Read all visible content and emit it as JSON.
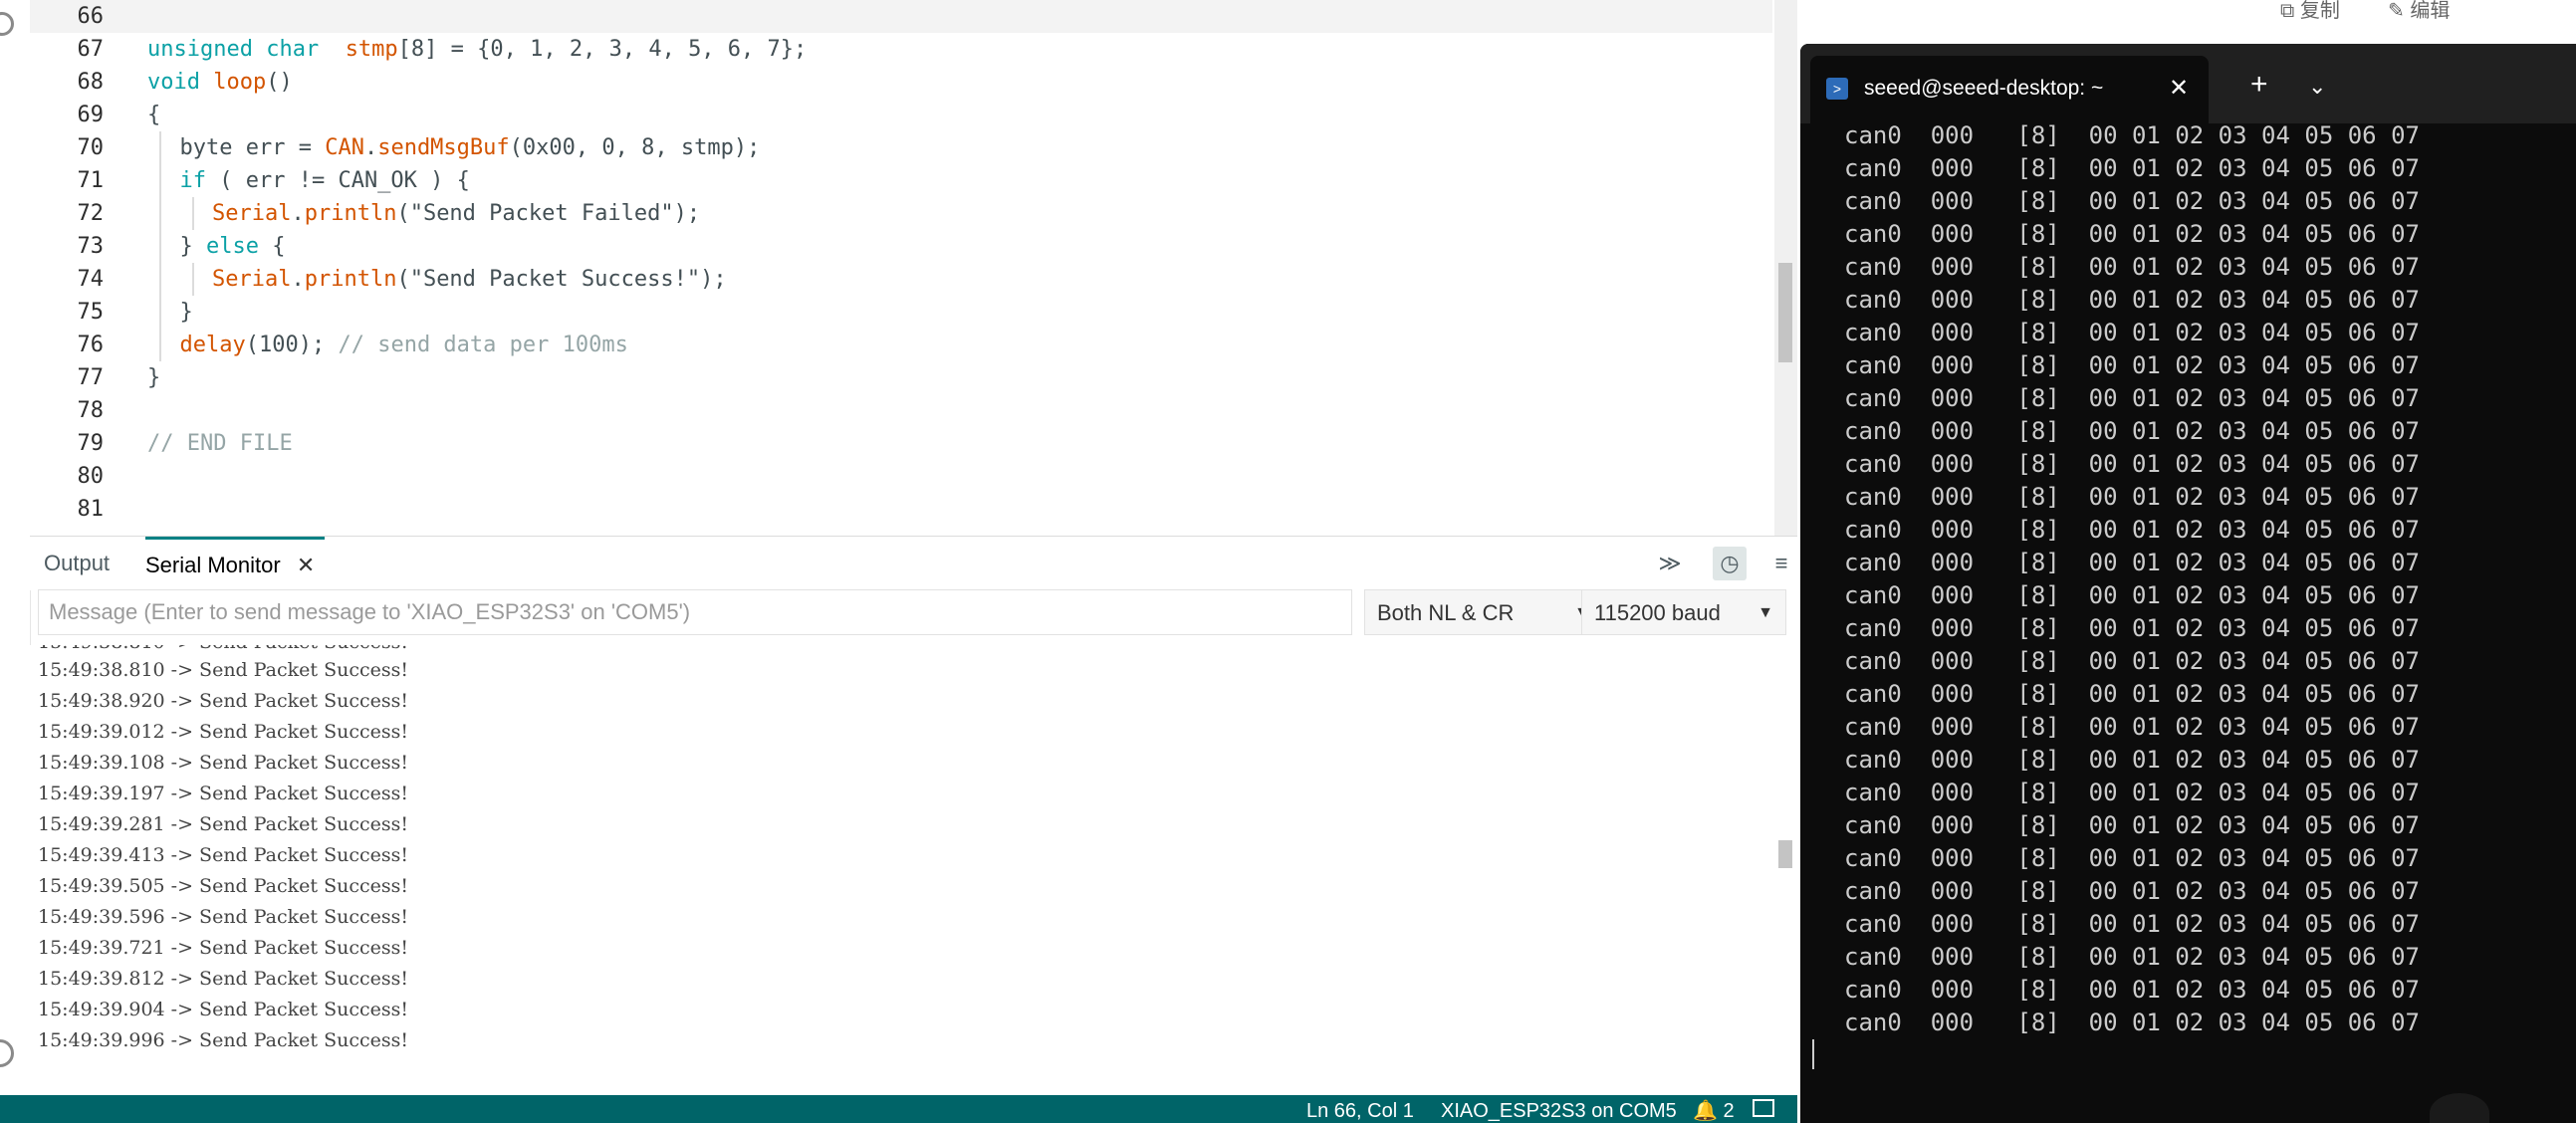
{
  "editor": {
    "lines": [
      {
        "num": "66",
        "tokens": [],
        "current": true
      },
      {
        "num": "67",
        "tokens": [
          [
            "kw",
            "unsigned char"
          ],
          [
            "",
            "  "
          ],
          [
            "fn",
            "stmp"
          ],
          [
            "",
            "[8] = {0, 1, 2, 3, 4, 5, 6, 7};"
          ]
        ]
      },
      {
        "num": "68",
        "tokens": [
          [
            "kw",
            "void"
          ],
          [
            "",
            " "
          ],
          [
            "fn",
            "loop"
          ],
          [
            "",
            "()"
          ]
        ]
      },
      {
        "num": "69",
        "tokens": [
          [
            "",
            "{"
          ]
        ]
      },
      {
        "num": "70",
        "indent": 1,
        "tokens": [
          [
            "",
            "byte err = "
          ],
          [
            "fn",
            "CAN"
          ],
          [
            "",
            "."
          ],
          [
            "fn",
            "sendMsgBuf"
          ],
          [
            "",
            "(0x00, 0, 8, stmp);"
          ]
        ]
      },
      {
        "num": "71",
        "indent": 1,
        "tokens": [
          [
            "kw",
            "if"
          ],
          [
            "",
            " ( err != CAN_OK ) {"
          ]
        ]
      },
      {
        "num": "72",
        "indent": 2,
        "tokens": [
          [
            "fn",
            "Serial"
          ],
          [
            "",
            "."
          ],
          [
            "fn",
            "println"
          ],
          [
            "",
            "(\"Send Packet Failed\");"
          ]
        ]
      },
      {
        "num": "73",
        "indent": 1,
        "tokens": [
          [
            "",
            "} "
          ],
          [
            "kw",
            "else"
          ],
          [
            "",
            " {"
          ]
        ]
      },
      {
        "num": "74",
        "indent": 2,
        "tokens": [
          [
            "fn",
            "Serial"
          ],
          [
            "",
            "."
          ],
          [
            "fn",
            "println"
          ],
          [
            "",
            "(\"Send Packet Success!\");"
          ]
        ]
      },
      {
        "num": "75",
        "indent": 1,
        "tokens": [
          [
            "",
            "}"
          ]
        ]
      },
      {
        "num": "76",
        "indent": 1,
        "tokens": [
          [
            "fn",
            "delay"
          ],
          [
            "",
            "(100);"
          ],
          [
            "",
            " "
          ],
          [
            "cm",
            "// send data per 100ms"
          ]
        ]
      },
      {
        "num": "77",
        "tokens": [
          [
            "",
            "}"
          ]
        ]
      },
      {
        "num": "78",
        "tokens": []
      },
      {
        "num": "79",
        "tokens": [
          [
            "cm",
            "// END FILE"
          ]
        ]
      },
      {
        "num": "80",
        "tokens": []
      },
      {
        "num": "81",
        "tokens": []
      }
    ]
  },
  "panel": {
    "tabs": {
      "output": "Output",
      "serial_monitor": "Serial Monitor",
      "close": "✕"
    },
    "buttons": {
      "collapse": "≫",
      "timestamp": "◷",
      "clear": "≡"
    },
    "message_placeholder": "Message (Enter to send message to 'XIAO_ESP32S3' on 'COM5')",
    "line_ending": "Both NL & CR",
    "baud": "115200 baud"
  },
  "serial_lines": [
    "15:49:38.810 -> Send Packet Success!",
    "15:49:38.920 -> Send Packet Success!",
    "15:49:39.012 -> Send Packet Success!",
    "15:49:39.108 -> Send Packet Success!",
    "15:49:39.197 -> Send Packet Success!",
    "15:49:39.281 -> Send Packet Success!",
    "15:49:39.413 -> Send Packet Success!",
    "15:49:39.505 -> Send Packet Success!",
    "15:49:39.596 -> Send Packet Success!",
    "15:49:39.721 -> Send Packet Success!",
    "15:49:39.812 -> Send Packet Success!",
    "15:49:39.904 -> Send Packet Success!",
    "15:49:39.996 -> Send Packet Success!"
  ],
  "status": {
    "position": "Ln 66, Col 1",
    "board": "XIAO_ESP32S3 on COM5",
    "notifications": "2"
  },
  "browser": {
    "copy": "复制",
    "edit": "编辑"
  },
  "terminal": {
    "tab_title": "seeed@seeed-desktop: ~",
    "close": "✕",
    "new_tab": "+",
    "dropdown": "⌄",
    "line": "can0  000   [8]  00 01 02 03 04 05 06 07",
    "line_count": 28
  },
  "colors": {
    "accent": "#008184",
    "statusbar": "#006468",
    "terminal_bg": "#0c0c0c",
    "terminal_titlebar": "#202020"
  }
}
